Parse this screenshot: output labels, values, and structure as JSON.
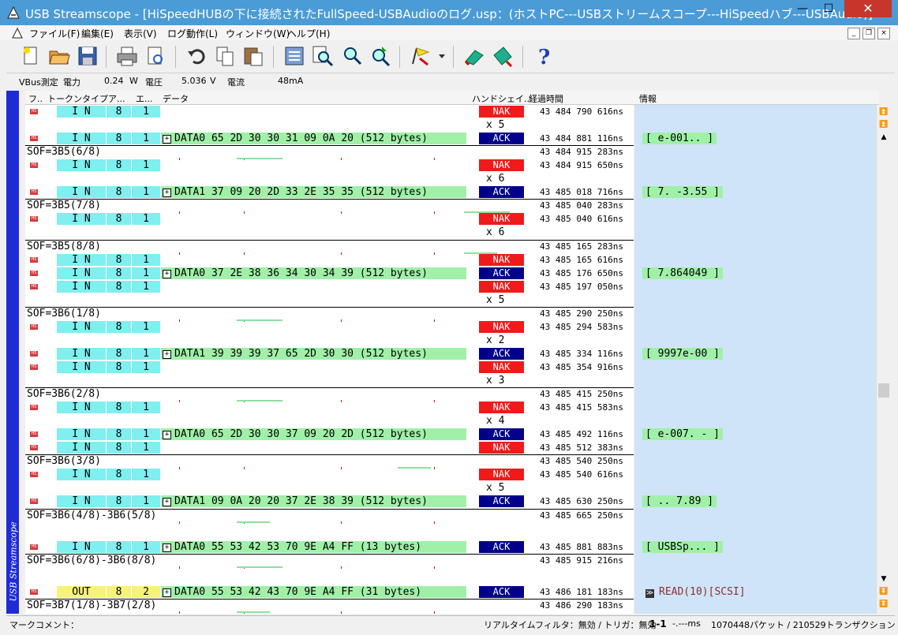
{
  "window": {
    "title": "USB Streamscope - [HiSpeedHUBの下に接続されたFullSpeed-USBAudioのログ.usp：(ホストPC---USBストリームスコープ---HiSpeedハブ---USBAudio)]",
    "min_glyph": "—",
    "max_glyph": "☐",
    "close_glyph": "✕"
  },
  "menu": {
    "items": [
      "ファイル(F)",
      "編集(E)",
      "表示(V)",
      "ログ動作(L)",
      "ウィンドウ(W)",
      "ヘルプ(H)"
    ],
    "mdi": [
      "_",
      "❐",
      "×"
    ]
  },
  "vbus": {
    "label": "VBus測定",
    "power_label": "電力",
    "power_value": "0.24",
    "power_unit": "W",
    "voltage_label": "電圧",
    "voltage_value": "5.036",
    "voltage_unit": "V",
    "current_label": "電流",
    "current_value": "48",
    "current_unit": "mA"
  },
  "sidebar_label": "USB Streamscope",
  "columns": [
    "フ..",
    "トークンタイプ",
    "ア...",
    "エ...",
    "データ",
    "ハンドシェイ...",
    "経過時間",
    "情報"
  ],
  "rows": [
    {
      "kind": "pkt",
      "token": "I N",
      "addr": "8",
      "ep": "1",
      "data": "",
      "hs": "NAK",
      "time": "43 484 790 616ns"
    },
    {
      "kind": "rep",
      "text": "x 5"
    },
    {
      "kind": "pkt",
      "token": "I N",
      "addr": "8",
      "ep": "1",
      "data": "DATA0 65 2D 30 30 31 09 0A 20 (512 bytes)",
      "hs": "ACK",
      "time": "43 484 881 116ns",
      "info": "[ e-001.. ]"
    },
    {
      "kind": "sof",
      "text": "SOF=3B5(6/8)",
      "time": "43 484 915 283ns",
      "sep": true
    },
    {
      "kind": "pkt",
      "token": "I N",
      "addr": "8",
      "ep": "1",
      "data": "",
      "hs": "NAK",
      "time": "43 484 915 650ns"
    },
    {
      "kind": "rep",
      "text": "x 6"
    },
    {
      "kind": "pkt",
      "token": "I N",
      "addr": "8",
      "ep": "1",
      "data": "DATA1 37 09 20 2D 33 2E 35 35 (512 bytes)",
      "hs": "ACK",
      "time": "43 485 018 716ns",
      "info": "[ 7. -3.55 ]"
    },
    {
      "kind": "sof",
      "text": "SOF=3B5(7/8)",
      "time": "43 485 040 283ns",
      "sep": true
    },
    {
      "kind": "pkt",
      "token": "I N",
      "addr": "8",
      "ep": "1",
      "data": "",
      "hs": "NAK",
      "time": "43 485 040 616ns"
    },
    {
      "kind": "rep",
      "text": "x 6"
    },
    {
      "kind": "sof",
      "text": "SOF=3B5(8/8)",
      "time": "43 485 165 283ns",
      "sep": true
    },
    {
      "kind": "pkt",
      "token": "I N",
      "addr": "8",
      "ep": "1",
      "data": "",
      "hs": "NAK",
      "time": "43 485 165 616ns"
    },
    {
      "kind": "pkt",
      "token": "I N",
      "addr": "8",
      "ep": "1",
      "data": "DATA0 37 2E 38 36 34 30 34 39 (512 bytes)",
      "hs": "ACK",
      "time": "43 485 176 650ns",
      "info": "[ 7.864049 ]"
    },
    {
      "kind": "pkt",
      "token": "I N",
      "addr": "8",
      "ep": "1",
      "data": "",
      "hs": "NAK",
      "time": "43 485 197 050ns"
    },
    {
      "kind": "rep",
      "text": "x 5"
    },
    {
      "kind": "sof",
      "text": "SOF=3B6(1/8)",
      "time": "43 485 290 250ns",
      "sep": true
    },
    {
      "kind": "pkt",
      "token": "I N",
      "addr": "8",
      "ep": "1",
      "data": "",
      "hs": "NAK",
      "time": "43 485 294 583ns"
    },
    {
      "kind": "rep",
      "text": "x 2"
    },
    {
      "kind": "pkt",
      "token": "I N",
      "addr": "8",
      "ep": "1",
      "data": "DATA1 39 39 39 37 65 2D 30 30 (512 bytes)",
      "hs": "ACK",
      "time": "43 485 334 116ns",
      "info": "[ 9997e-00 ]"
    },
    {
      "kind": "pkt",
      "token": "I N",
      "addr": "8",
      "ep": "1",
      "data": "",
      "hs": "NAK",
      "time": "43 485 354 916ns"
    },
    {
      "kind": "rep",
      "text": "x 3"
    },
    {
      "kind": "sof",
      "text": "SOF=3B6(2/8)",
      "time": "43 485 415 250ns",
      "sep": true
    },
    {
      "kind": "pkt",
      "token": "I N",
      "addr": "8",
      "ep": "1",
      "data": "",
      "hs": "NAK",
      "time": "43 485 415 583ns"
    },
    {
      "kind": "rep",
      "text": "x 4"
    },
    {
      "kind": "pkt",
      "token": "I N",
      "addr": "8",
      "ep": "1",
      "data": "DATA0 65 2D 30 30 37 09 20 2D (512 bytes)",
      "hs": "ACK",
      "time": "43 485 492 116ns",
      "info": "[ e-007. - ]"
    },
    {
      "kind": "pkt",
      "token": "I N",
      "addr": "8",
      "ep": "1",
      "data": "",
      "hs": "NAK",
      "time": "43 485 512 383ns"
    },
    {
      "kind": "sof",
      "text": "SOF=3B6(3/8)",
      "time": "43 485 540 250ns",
      "sep": true
    },
    {
      "kind": "pkt",
      "token": "I N",
      "addr": "8",
      "ep": "1",
      "data": "",
      "hs": "NAK",
      "time": "43 485 540 616ns"
    },
    {
      "kind": "rep",
      "text": "x 5"
    },
    {
      "kind": "pkt",
      "token": "I N",
      "addr": "8",
      "ep": "1",
      "data": "DATA1 09 0A 20 20 37 2E 38 39 (512 bytes)",
      "hs": "ACK",
      "time": "43 485 630 250ns",
      "info": "[ ..  7.89 ]"
    },
    {
      "kind": "sof",
      "text": "SOF=3B6(4/8)-3B6(5/8)",
      "time": "43 485 665 250ns",
      "sep": true
    },
    {
      "kind": "gap"
    },
    {
      "kind": "pkt",
      "token": "I N",
      "addr": "8",
      "ep": "1",
      "data": "DATA0 55 53 42 53 70 9E A4 FF (13 bytes)",
      "hs": "ACK",
      "time": "43 485 881 883ns",
      "info": "[ USBSp... ]"
    },
    {
      "kind": "sof",
      "text": "SOF=3B6(6/8)-3B6(8/8)",
      "time": "43 485 915 216ns",
      "sep": true
    },
    {
      "kind": "gap"
    },
    {
      "kind": "pkt",
      "token": "OUT",
      "addr": "8",
      "ep": "2",
      "out": true,
      "data": "DATA0 55 53 42 43 70 9E A4 FF (31 bytes)",
      "hs": "ACK",
      "time": "43 486 181 183ns",
      "info": "READ(10)[SCSI]",
      "cmd": true
    },
    {
      "kind": "sof",
      "text": "SOF=3B7(1/8)-3B7(2/8)",
      "time": "43 486 290 183ns",
      "sep": true
    },
    {
      "kind": "partial"
    }
  ],
  "statusbar": {
    "marker_comment": "マークコメント：",
    "filter": "リアルタイムフィルタ：無効 / トリガ：無効",
    "range": "1-1",
    "range_ms": "-.---ms",
    "counts": "1070448パケット / 210529トランザクション"
  },
  "colors": {
    "title_bg": "#4a9bd6",
    "token_bg": "#7fefef",
    "out_bg": "#f7f27a",
    "data_bg": "#a0f0a8",
    "nak": "#f01a1a",
    "ack": "#00008b",
    "info_bg": "#cfe4f8",
    "sidebar": "#1e2bd6"
  },
  "icons": [
    "new-file-icon",
    "open-folder-icon",
    "save-icon",
    "print-icon",
    "print-preview-icon",
    "undo-icon",
    "copy-icon",
    "paste-icon",
    "settings-icon",
    "search-icon",
    "search-back-icon",
    "search-next-icon",
    "flag-icon",
    "dropdown-icon",
    "marker-prev-icon",
    "marker-next-icon",
    "help-icon"
  ]
}
